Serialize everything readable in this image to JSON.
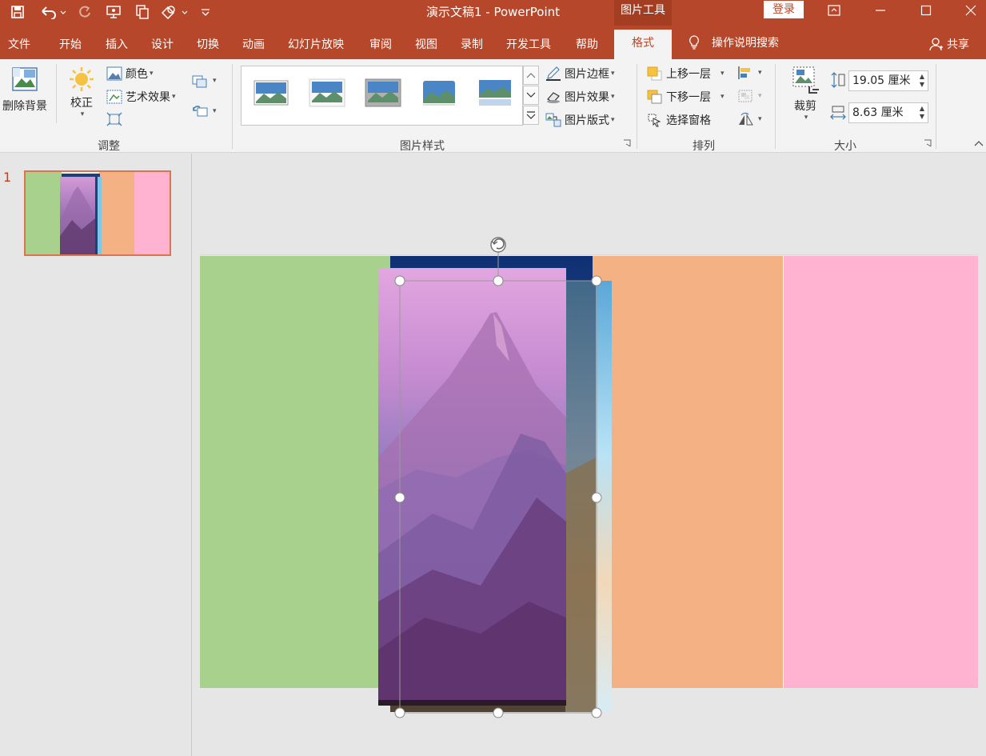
{
  "window": {
    "title": "演示文稿1  -  PowerPoint",
    "contextual_tools_label": "图片工具",
    "login_label": "登录"
  },
  "tabs": [
    {
      "label": "文件"
    },
    {
      "label": "开始"
    },
    {
      "label": "插入"
    },
    {
      "label": "设计"
    },
    {
      "label": "切换"
    },
    {
      "label": "动画"
    },
    {
      "label": "幻灯片放映"
    },
    {
      "label": "审阅"
    },
    {
      "label": "视图"
    },
    {
      "label": "录制"
    },
    {
      "label": "开发工具"
    },
    {
      "label": "帮助"
    }
  ],
  "active_tab": {
    "label": "格式"
  },
  "tell_me": {
    "label": "操作说明搜索",
    "icon": "lightbulb-icon"
  },
  "share": {
    "label": "共享",
    "icon": "person-icon"
  },
  "ribbon": {
    "adjust": {
      "remove_bg": "删除背景",
      "corrections": "校正",
      "color": "颜色",
      "artistic": "艺术效果",
      "group_label": "调整"
    },
    "picture_styles": {
      "border": "图片边框",
      "effects": "图片效果",
      "layout": "图片版式",
      "group_label": "图片样式"
    },
    "arrange": {
      "bring_forward": "上移一层",
      "send_backward": "下移一层",
      "selection_pane": "选择窗格",
      "group_label": "排列"
    },
    "size": {
      "crop": "裁剪",
      "height": "19.05 厘米",
      "width": "8.63 厘米",
      "group_label": "大小"
    }
  },
  "thumbnails": [
    {
      "number": "1"
    }
  ],
  "slide": {
    "panel_colors": [
      "#a9d18e",
      "#f4b183",
      "#ffb3d0"
    ],
    "selected_picture": {
      "subject": "purple mountain peak"
    },
    "accent": "#b7472a"
  }
}
